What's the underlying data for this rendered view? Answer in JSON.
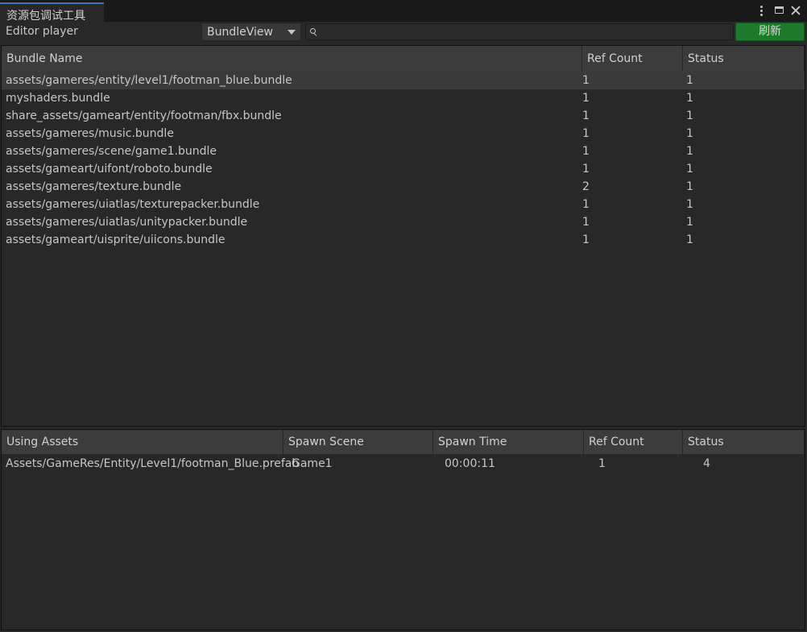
{
  "window": {
    "tab_title": "资源包调试工具",
    "menu_icon": "kebab-menu-icon",
    "maximize_icon": "maximize-icon",
    "close_icon": "close-icon"
  },
  "toolbar": {
    "player_label": "Editor player",
    "view_select": {
      "selected": "BundleView"
    },
    "search": {
      "value": "",
      "placeholder": ""
    },
    "refresh_label": "刷新",
    "refresh_color": "#1e7a2b"
  },
  "bundles": {
    "columns": [
      "Bundle Name",
      "Ref Count",
      "Status"
    ],
    "rows": [
      {
        "name": "assets/gameres/entity/level1/footman_blue.bundle",
        "ref_count": "1",
        "status": "1"
      },
      {
        "name": "myshaders.bundle",
        "ref_count": "1",
        "status": "1"
      },
      {
        "name": "share_assets/gameart/entity/footman/fbx.bundle",
        "ref_count": "1",
        "status": "1"
      },
      {
        "name": "assets/gameres/music.bundle",
        "ref_count": "1",
        "status": "1"
      },
      {
        "name": "assets/gameres/scene/game1.bundle",
        "ref_count": "1",
        "status": "1"
      },
      {
        "name": "assets/gameart/uifont/roboto.bundle",
        "ref_count": "1",
        "status": "1"
      },
      {
        "name": "assets/gameres/texture.bundle",
        "ref_count": "2",
        "status": "1"
      },
      {
        "name": "assets/gameres/uiatlas/texturepacker.bundle",
        "ref_count": "1",
        "status": "1"
      },
      {
        "name": "assets/gameres/uiatlas/unitypacker.bundle",
        "ref_count": "1",
        "status": "1"
      },
      {
        "name": "assets/gameart/uisprite/uiicons.bundle",
        "ref_count": "1",
        "status": "1"
      }
    ]
  },
  "assets": {
    "columns": [
      "Using Assets",
      "Spawn Scene",
      "Spawn Time",
      "Ref Count",
      "Status"
    ],
    "rows": [
      {
        "asset": "Assets/GameRes/Entity/Level1/footman_Blue.prefab",
        "scene": "Game1",
        "time": "00:00:11",
        "ref_count": "1",
        "status": "4"
      }
    ]
  }
}
